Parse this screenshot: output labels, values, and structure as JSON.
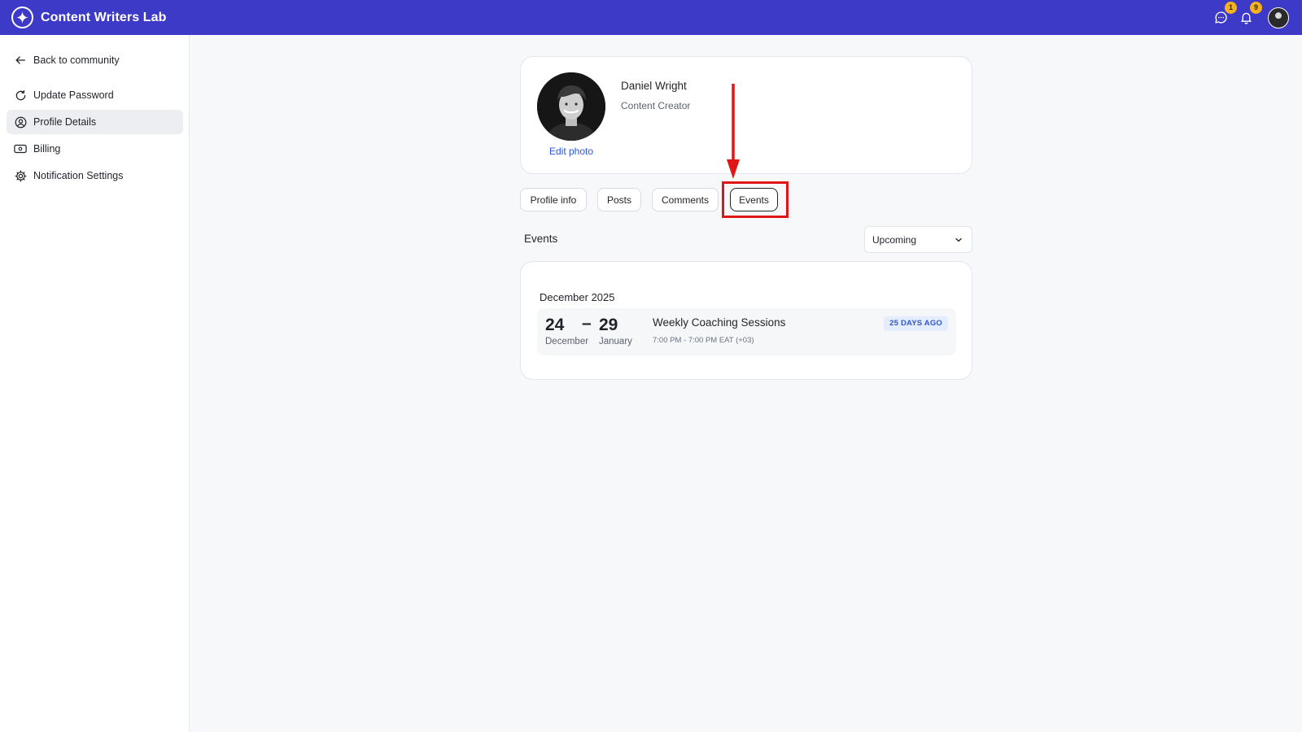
{
  "app": {
    "title": "Content Writers Lab"
  },
  "header": {
    "messages_count": "1",
    "notifications_count": "9"
  },
  "sidebar": {
    "back_label": "Back to community",
    "items": [
      {
        "label": "Update Password",
        "icon": "refresh-icon"
      },
      {
        "label": "Profile Details",
        "icon": "user-circle-icon",
        "active": true
      },
      {
        "label": "Billing",
        "icon": "billing-icon"
      },
      {
        "label": "Notification Settings",
        "icon": "gear-icon"
      }
    ]
  },
  "profile": {
    "name": "Daniel Wright",
    "role": "Content Creator",
    "edit_photo": "Edit photo"
  },
  "tabs": [
    {
      "label": "Profile info"
    },
    {
      "label": "Posts"
    },
    {
      "label": "Comments"
    },
    {
      "label": "Events",
      "active": true
    }
  ],
  "events": {
    "title": "Events",
    "filter": {
      "selected": "Upcoming"
    },
    "groups": [
      {
        "month": "December 2025",
        "items": [
          {
            "start_day": "24",
            "start_month": "December",
            "end_day": "29",
            "end_month": "January",
            "title": "Weekly Coaching Sessions",
            "time": "7:00 PM - 7:00 PM EAT (+03)",
            "badge": "25 DAYS AGO"
          }
        ]
      }
    ]
  },
  "colors": {
    "brand": "#3d3ac8",
    "highlight": "#e01616",
    "badge": "#f5b120",
    "link": "#2b56d6"
  }
}
